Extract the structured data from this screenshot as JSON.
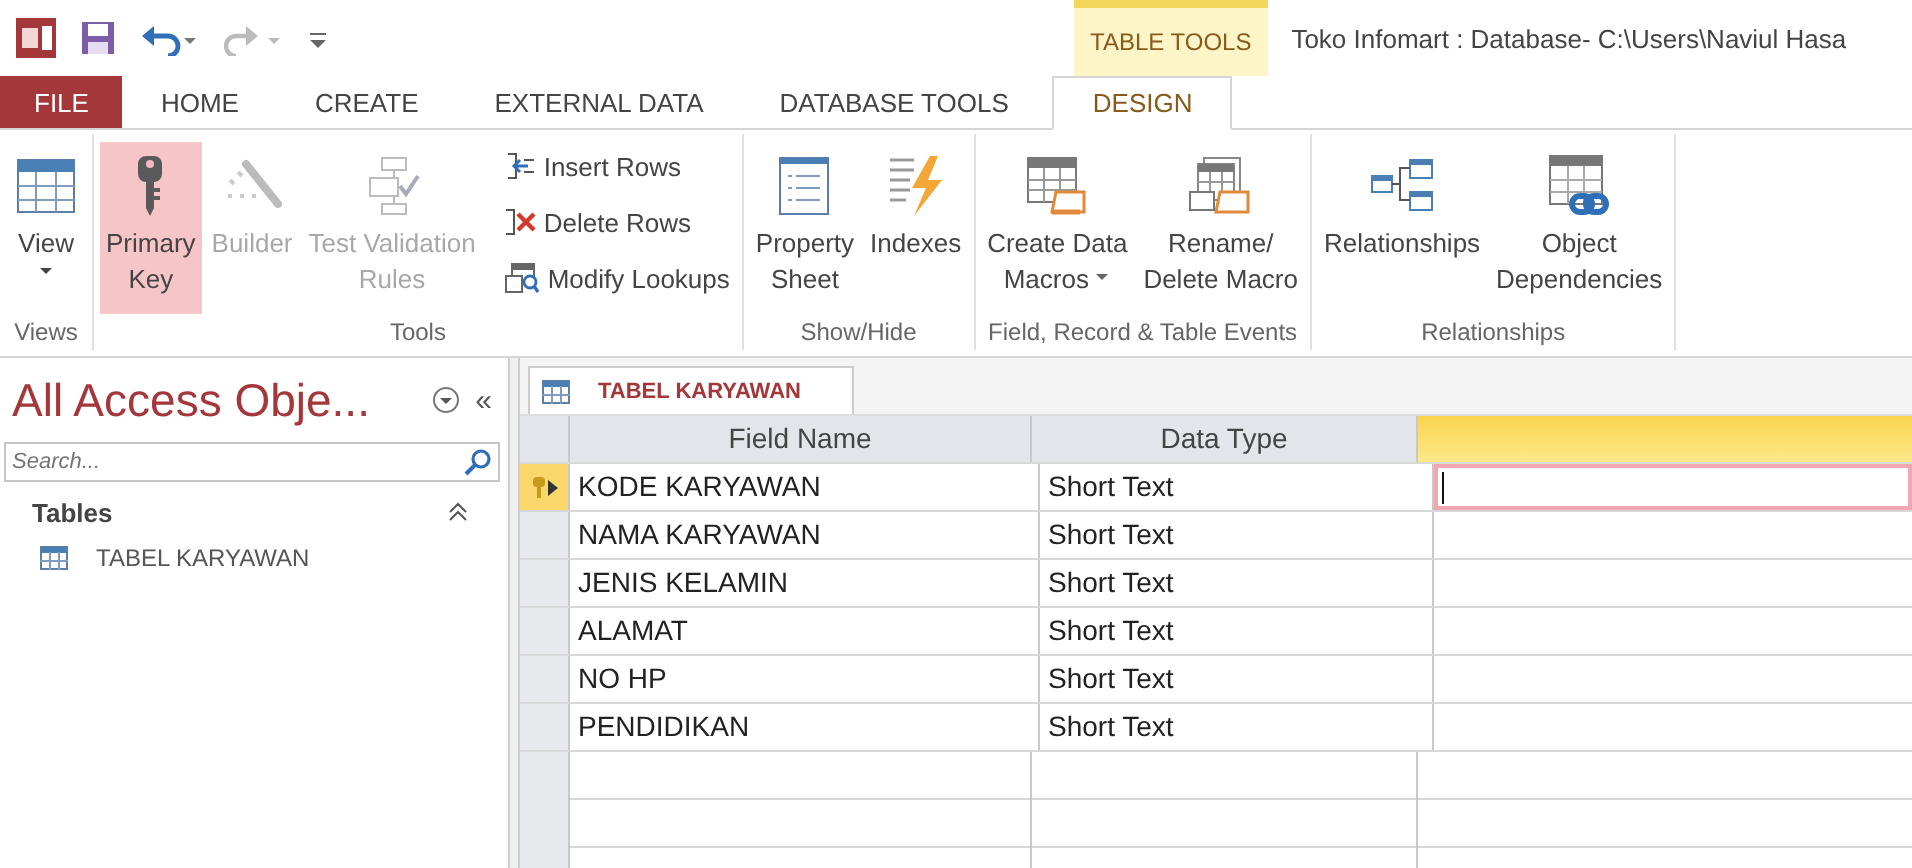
{
  "contextual_tab": {
    "label": "TABLE TOOLS"
  },
  "window": {
    "title": "Toko Infomart : Database- C:\\Users\\Naviul Hasa"
  },
  "ribbon_tabs": [
    {
      "label": "FILE",
      "kind": "backstage",
      "selected": false
    },
    {
      "label": "HOME",
      "kind": "normal",
      "selected": false
    },
    {
      "label": "CREATE",
      "kind": "normal",
      "selected": false
    },
    {
      "label": "EXTERNAL DATA",
      "kind": "normal",
      "selected": false
    },
    {
      "label": "DATABASE TOOLS",
      "kind": "normal",
      "selected": false
    },
    {
      "label": "DESIGN",
      "kind": "contextual",
      "selected": true
    }
  ],
  "ribbon_groups": [
    {
      "label": "Views",
      "commands": [
        {
          "label": "View",
          "kind": "split",
          "dropdown": true,
          "selected": false,
          "disabled": false
        }
      ]
    },
    {
      "label": "Tools",
      "commands": [
        {
          "label": "Primary\nKey",
          "kind": "large",
          "dropdown": false,
          "selected": true,
          "disabled": false
        },
        {
          "label": "Builder",
          "kind": "large",
          "dropdown": false,
          "selected": false,
          "disabled": true
        },
        {
          "label": "Test Validation\nRules",
          "kind": "large",
          "dropdown": false,
          "selected": false,
          "disabled": true
        },
        {
          "label": "Insert Rows",
          "kind": "small",
          "dropdown": false,
          "selected": false,
          "disabled": false
        },
        {
          "label": "Delete Rows",
          "kind": "small",
          "dropdown": false,
          "selected": false,
          "disabled": false
        },
        {
          "label": "Modify Lookups",
          "kind": "small",
          "dropdown": false,
          "selected": false,
          "disabled": false
        }
      ]
    },
    {
      "label": "Show/Hide",
      "commands": [
        {
          "label": "Property\nSheet",
          "kind": "large",
          "dropdown": false,
          "selected": false,
          "disabled": false
        },
        {
          "label": "Indexes",
          "kind": "large",
          "dropdown": false,
          "selected": false,
          "disabled": false
        }
      ]
    },
    {
      "label": "Field, Record & Table Events",
      "commands": [
        {
          "label": "Create Data\nMacros",
          "kind": "large",
          "dropdown": true,
          "selected": false,
          "disabled": false
        },
        {
          "label": "Rename/\nDelete Macro",
          "kind": "large",
          "dropdown": false,
          "selected": false,
          "disabled": false
        }
      ]
    },
    {
      "label": "Relationships",
      "commands": [
        {
          "label": "Relationships",
          "kind": "large",
          "dropdown": false,
          "selected": false,
          "disabled": false
        },
        {
          "label": "Object\nDependencies",
          "kind": "large",
          "dropdown": false,
          "selected": false,
          "disabled": false
        }
      ]
    }
  ],
  "navigation_pane": {
    "title": "All Access Obje...",
    "collapse_glyph": "«",
    "search": {
      "placeholder": "Search..."
    },
    "groups": [
      {
        "label": "Tables",
        "expanded": true,
        "items": [
          {
            "label": "TABEL KARYAWAN",
            "selected": false
          }
        ]
      }
    ]
  },
  "document": {
    "tabs": [
      {
        "label": "TABEL KARYAWAN",
        "selected": true
      }
    ],
    "columns": [
      {
        "label": "Field Name",
        "selected": false
      },
      {
        "label": "Data Type",
        "selected": false
      },
      {
        "selected": true
      }
    ],
    "rows": [
      {
        "field_name": "KODE KARYAWAN",
        "data_type": "Short Text",
        "primary_key": true,
        "current": true
      },
      {
        "field_name": "NAMA KARYAWAN",
        "data_type": "Short Text",
        "primary_key": false,
        "current": false
      },
      {
        "field_name": "JENIS KELAMIN",
        "data_type": "Short Text",
        "primary_key": false,
        "current": false
      },
      {
        "field_name": "ALAMAT",
        "data_type": "Short Text",
        "primary_key": false,
        "current": false
      },
      {
        "field_name": "NO HP",
        "data_type": "Short Text",
        "primary_key": false,
        "current": false
      },
      {
        "field_name": "PENDIDIKAN",
        "data_type": "Short Text",
        "primary_key": false,
        "current": false
      }
    ]
  }
}
